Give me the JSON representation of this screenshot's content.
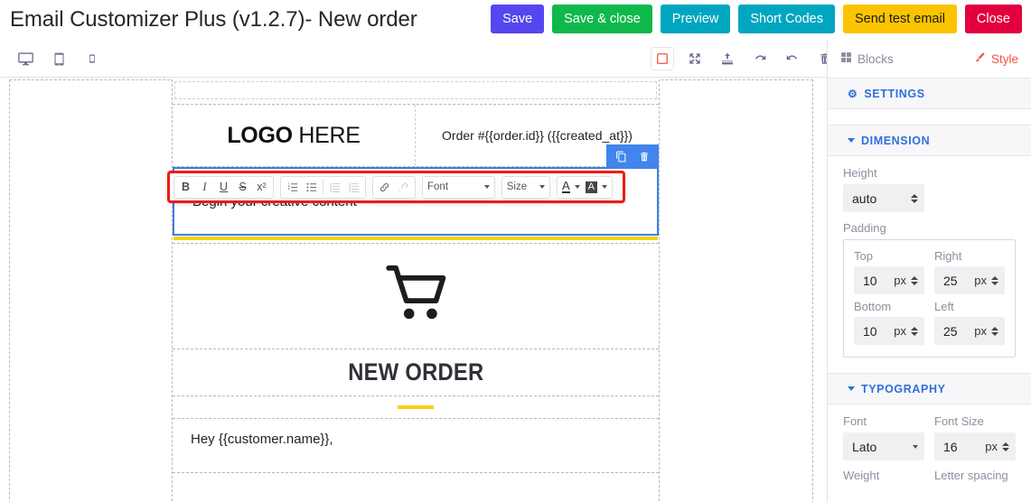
{
  "header": {
    "title": "Email Customizer Plus (v1.2.7)- New order",
    "buttons": [
      {
        "label": "Save",
        "name": "save-button"
      },
      {
        "label": "Save & close",
        "name": "save-and-close-button"
      },
      {
        "label": "Preview",
        "name": "preview-button"
      },
      {
        "label": "Short Codes",
        "name": "short-codes-button"
      },
      {
        "label": "Send test email",
        "name": "send-test-email-button"
      },
      {
        "label": "Close",
        "name": "close-button"
      }
    ]
  },
  "toolbar": {
    "devices": [
      {
        "icon": "desktop-icon",
        "label": "Desktop"
      },
      {
        "icon": "tablet-icon",
        "label": "Tablet"
      },
      {
        "icon": "mobile-icon",
        "label": "Mobile"
      }
    ],
    "tools": [
      {
        "icon": "borders-toggle-icon",
        "label": "Toggle borders",
        "active": true
      },
      {
        "icon": "fullscreen-icon",
        "label": "Fullscreen"
      },
      {
        "icon": "export-icon",
        "label": "Export"
      },
      {
        "icon": "undo-icon",
        "label": "Undo"
      },
      {
        "icon": "redo-icon",
        "label": "Redo"
      },
      {
        "icon": "trash-icon",
        "label": "Clear canvas"
      }
    ],
    "tabs": {
      "blocks": "Blocks",
      "style": "Style"
    }
  },
  "rte": {
    "buttons": [
      {
        "label": "B",
        "name": "bold-button"
      },
      {
        "label": "I",
        "name": "italic-button"
      },
      {
        "label": "U",
        "name": "underline-button"
      },
      {
        "label": "S",
        "name": "strikethrough-button"
      },
      {
        "label": "x²",
        "name": "superscript-button"
      }
    ],
    "list_buttons": [
      {
        "name": "ordered-list-button"
      },
      {
        "name": "unordered-list-button"
      },
      {
        "name": "outdent-button"
      },
      {
        "name": "indent-button"
      }
    ],
    "link_buttons": [
      {
        "name": "insert-link-button"
      },
      {
        "name": "unlink-button"
      }
    ],
    "font_select": "Font",
    "size_select": "Size",
    "text_color": "A",
    "bg_color": "A"
  },
  "email": {
    "logo_bold": "LOGO",
    "logo_light": " HERE",
    "order_line": "Order #{{order.id}} ({{created_at}})",
    "editable_content": "Begin your creative content",
    "cart_icon": "shopping-cart-icon",
    "title": "NEW ORDER",
    "greeting": "Hey {{customer.name}},",
    "accent_color": "#f7d117",
    "selection_color": "#3e7fe0"
  },
  "settings": {
    "header_label": "SETTINGS",
    "dimension": {
      "label": "DIMENSION",
      "height_label": "Height",
      "height_value": "auto",
      "padding_label": "Padding",
      "fields": [
        {
          "label": "Top",
          "value": "10",
          "unit": "px"
        },
        {
          "label": "Right",
          "value": "25",
          "unit": "px"
        },
        {
          "label": "Bottom",
          "value": "10",
          "unit": "px"
        },
        {
          "label": "Left",
          "value": "25",
          "unit": "px"
        }
      ]
    },
    "typography": {
      "label": "TYPOGRAPHY",
      "font_label": "Font",
      "font_value": "Lato",
      "font_size_label": "Font Size",
      "font_size_value": "16",
      "font_size_unit": "px",
      "weight_label": "Weight",
      "letter_spacing_label": "Letter spacing"
    }
  }
}
